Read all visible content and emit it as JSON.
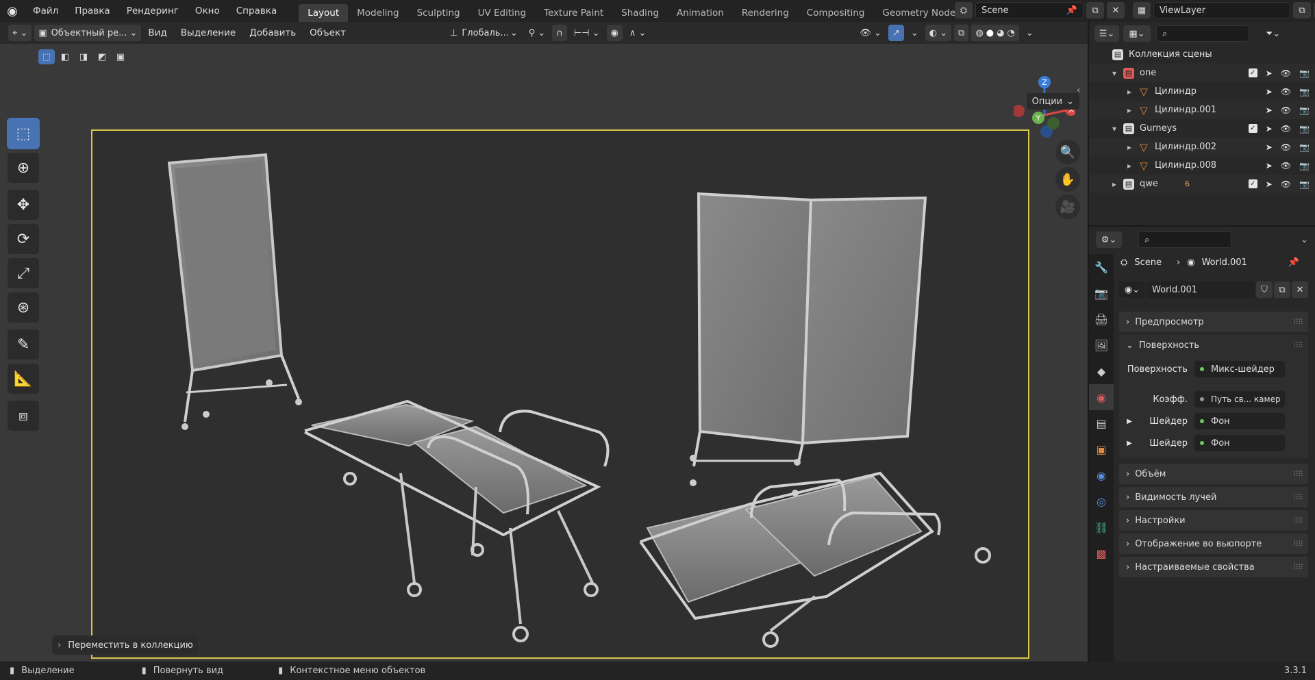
{
  "top_menu": [
    "Файл",
    "Правка",
    "Рендеринг",
    "Окно",
    "Справка"
  ],
  "workspaces": [
    "Layout",
    "Modeling",
    "Sculpting",
    "UV Editing",
    "Texture Paint",
    "Shading",
    "Animation",
    "Rendering",
    "Compositing",
    "Geometry Nodes",
    "Scripting"
  ],
  "active_workspace": "Layout",
  "scene_name": "Scene",
  "view_layer": "ViewLayer",
  "viewport_header": {
    "mode": "Объектный ре...",
    "menus": [
      "Вид",
      "Выделение",
      "Добавить",
      "Объект"
    ],
    "orientation": "Глобаль...",
    "options": "Опции"
  },
  "operator_panel": "Переместить в коллекцию",
  "status": {
    "left": "Выделение",
    "middle": "Повернуть вид",
    "right": "Контекстное меню объектов",
    "version": "3.3.1"
  },
  "outliner": {
    "root": "Коллекция сцены",
    "rows": [
      {
        "name": "one",
        "type": "collection",
        "indent": 1
      },
      {
        "name": "Цилиндр",
        "type": "mesh",
        "indent": 2
      },
      {
        "name": "Цилиндр.001",
        "type": "mesh",
        "indent": 2
      },
      {
        "name": "Gurneys",
        "type": "collection",
        "indent": 1
      },
      {
        "name": "Цилиндр.002",
        "type": "mesh",
        "indent": 2
      },
      {
        "name": "Цилиндр.008",
        "type": "mesh",
        "indent": 2
      },
      {
        "name": "qwe",
        "type": "collection",
        "indent": 1,
        "extra": "6"
      }
    ]
  },
  "properties": {
    "breadcrumb_scene": "Scene",
    "breadcrumb_world": "World.001",
    "world_name": "World.001",
    "panels": {
      "preview": "Предпросмотр",
      "surface": "Поверхность",
      "volume": "Объём",
      "ray_visibility": "Видимость лучей",
      "settings": "Настройки",
      "viewport_display": "Отображение во вьюпорте",
      "custom_props": "Настраиваемые свойства"
    },
    "surface_rows": [
      {
        "label": "Поверхность",
        "value": "Микс-шейдер"
      },
      {
        "label": "Коэфф.",
        "value": "Путь св... камер"
      },
      {
        "label": "Шейдер",
        "value": "Фон"
      },
      {
        "label": "Шейдер",
        "value": "Фон"
      }
    ]
  },
  "colors": {
    "accent": "#4772b3",
    "camera_frame": "#d8c84a",
    "collection_red": "#e05b5b",
    "mesh_orange": "#e08a3c"
  }
}
